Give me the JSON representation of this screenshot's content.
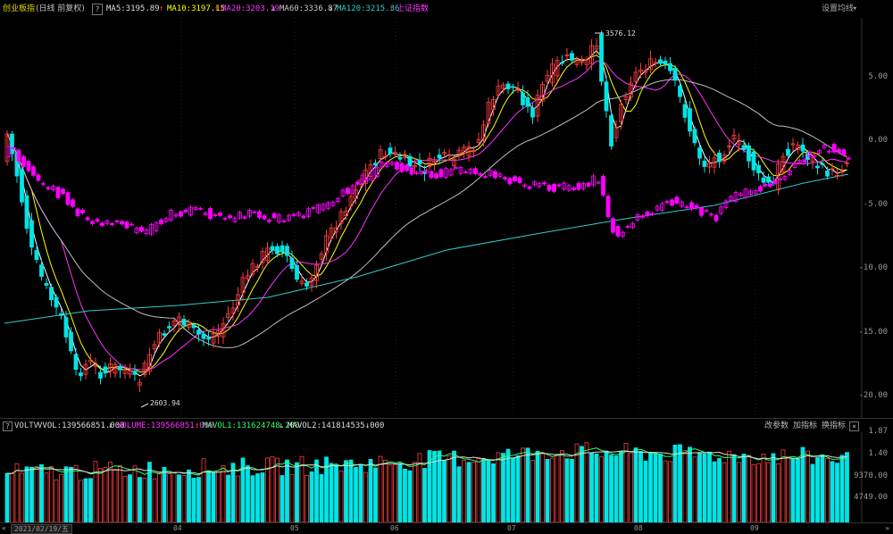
{
  "header": {
    "title": "创业板指",
    "subtitle": "(日线 前复权)",
    "help": "?",
    "ma5": "MA5:3195.89",
    "ma10": "MA10:3197.15",
    "ma20": "MA20:3203.19",
    "ma60": "MA60:3336.87",
    "ma120": "MA120:3215.36",
    "compare": "上证指数",
    "settings": "设置均线"
  },
  "price_axis": [
    "5.00",
    "0.00",
    "-5.00",
    "-10.00",
    "-15.00",
    "-20.00"
  ],
  "annotations": {
    "high": "3576.12",
    "low": "2603.94"
  },
  "volume_header": {
    "help": "?",
    "name": "VOLTV",
    "vvol": "VVOL:139566851.000",
    "volume": "VOLUME:139566851.000",
    "mavol1": "MAVOL1:131624748.200",
    "mavol2": "MAVOL2:141814535.000",
    "btn_params": "改参数",
    "btn_add": "加指标",
    "btn_swap": "换指标",
    "close": "×"
  },
  "volume_axis": [
    "1.87",
    "1.40",
    "9370.00",
    "4749.00"
  ],
  "bottom": {
    "date": "2021/02/19/五",
    "months": [
      "04",
      "05",
      "06",
      "07",
      "08",
      "09"
    ]
  },
  "colors": {
    "up": "#ff3c3c",
    "down": "#00e5e5",
    "compare": "#ff00ff",
    "ma5": "#ffffff",
    "ma10": "#ffff00",
    "ma20": "#ff33ff",
    "ma60": "#bfbfbf",
    "ma120": "#33cccc"
  }
}
